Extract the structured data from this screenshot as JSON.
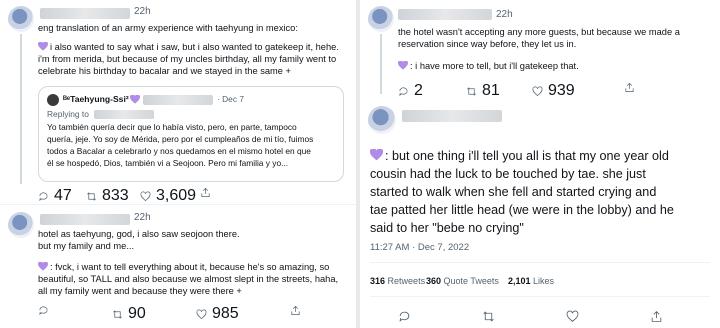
{
  "tweets": [
    {
      "handle_time": "22h",
      "text": [
        "eng translation of an army experience with taehyung in mexico:",
        "i also wanted to say what i saw, but i also wanted to gatekeep it, hehe.",
        "i'm from merida, but because of my uncles birthday, all my family went to",
        "celebrate his birthday to bacalar and we stayed in the same +"
      ],
      "quote": {
        "name": "ᴮᵉTaehyung-Ssi²",
        "date": "· Dec 7",
        "replying_label": "Replying to",
        "text": [
          "Yo también quería decir que lo había visto, pero, en parte, tampoco",
          "quería, jeje. Yo soy de Mérida, pero por el cumpleaños de mi tío, fuimos",
          "todos a Bacalar a celebrarlo y nos quedamos en el mismo hotel en que",
          "él se hospedó, Dios, también vi a Seojoon. Pero mi familia y yo..."
        ]
      },
      "replies": "47",
      "retweets": "833",
      "likes": "3,609"
    },
    {
      "handle_time": "22h",
      "text": [
        "hotel as taehyung, god, i also saw seojoon there.",
        "but my family and me...",
        "",
        ": fvck, i want to tell everything about it, because he's so amazing, so",
        "beautiful, so TALL and also because we almost slept in the streets, haha,",
        "all my family went and because they were there +"
      ],
      "replies": "",
      "retweets": "90",
      "likes": "985"
    },
    {
      "handle_time": "22h",
      "text": [
        "the hotel wasn't accepting any more guests, but because we made a",
        "reservation since way before, they let us in.",
        "",
        ": i have more to tell, but i'll gatekeep that."
      ],
      "replies": "2",
      "retweets": "81",
      "likes": "939"
    },
    {
      "text": [
        ": but one thing i'll tell you all is that my one year old",
        "cousin had the luck to be touched by tae. she just",
        "started to walk when she fell and started crying and",
        "tae patted her little head (we were in the lobby) and he",
        "said to her \"bebe no crying\""
      ],
      "timestamp": "11:27 AM · Dec 7, 2022",
      "stats": {
        "retweets_count": "316",
        "retweets_label": "Retweets",
        "quotes_count": "360",
        "quotes_label": "Quote Tweets",
        "likes_count": "2,101",
        "likes_label": "Likes"
      }
    }
  ],
  "colors": {
    "heart": "#b18ce6",
    "text": "#0f1419",
    "muted": "#536471"
  },
  "icons": [
    "reply-icon",
    "retweet-icon",
    "like-icon",
    "share-icon",
    "purple-heart-icon"
  ]
}
